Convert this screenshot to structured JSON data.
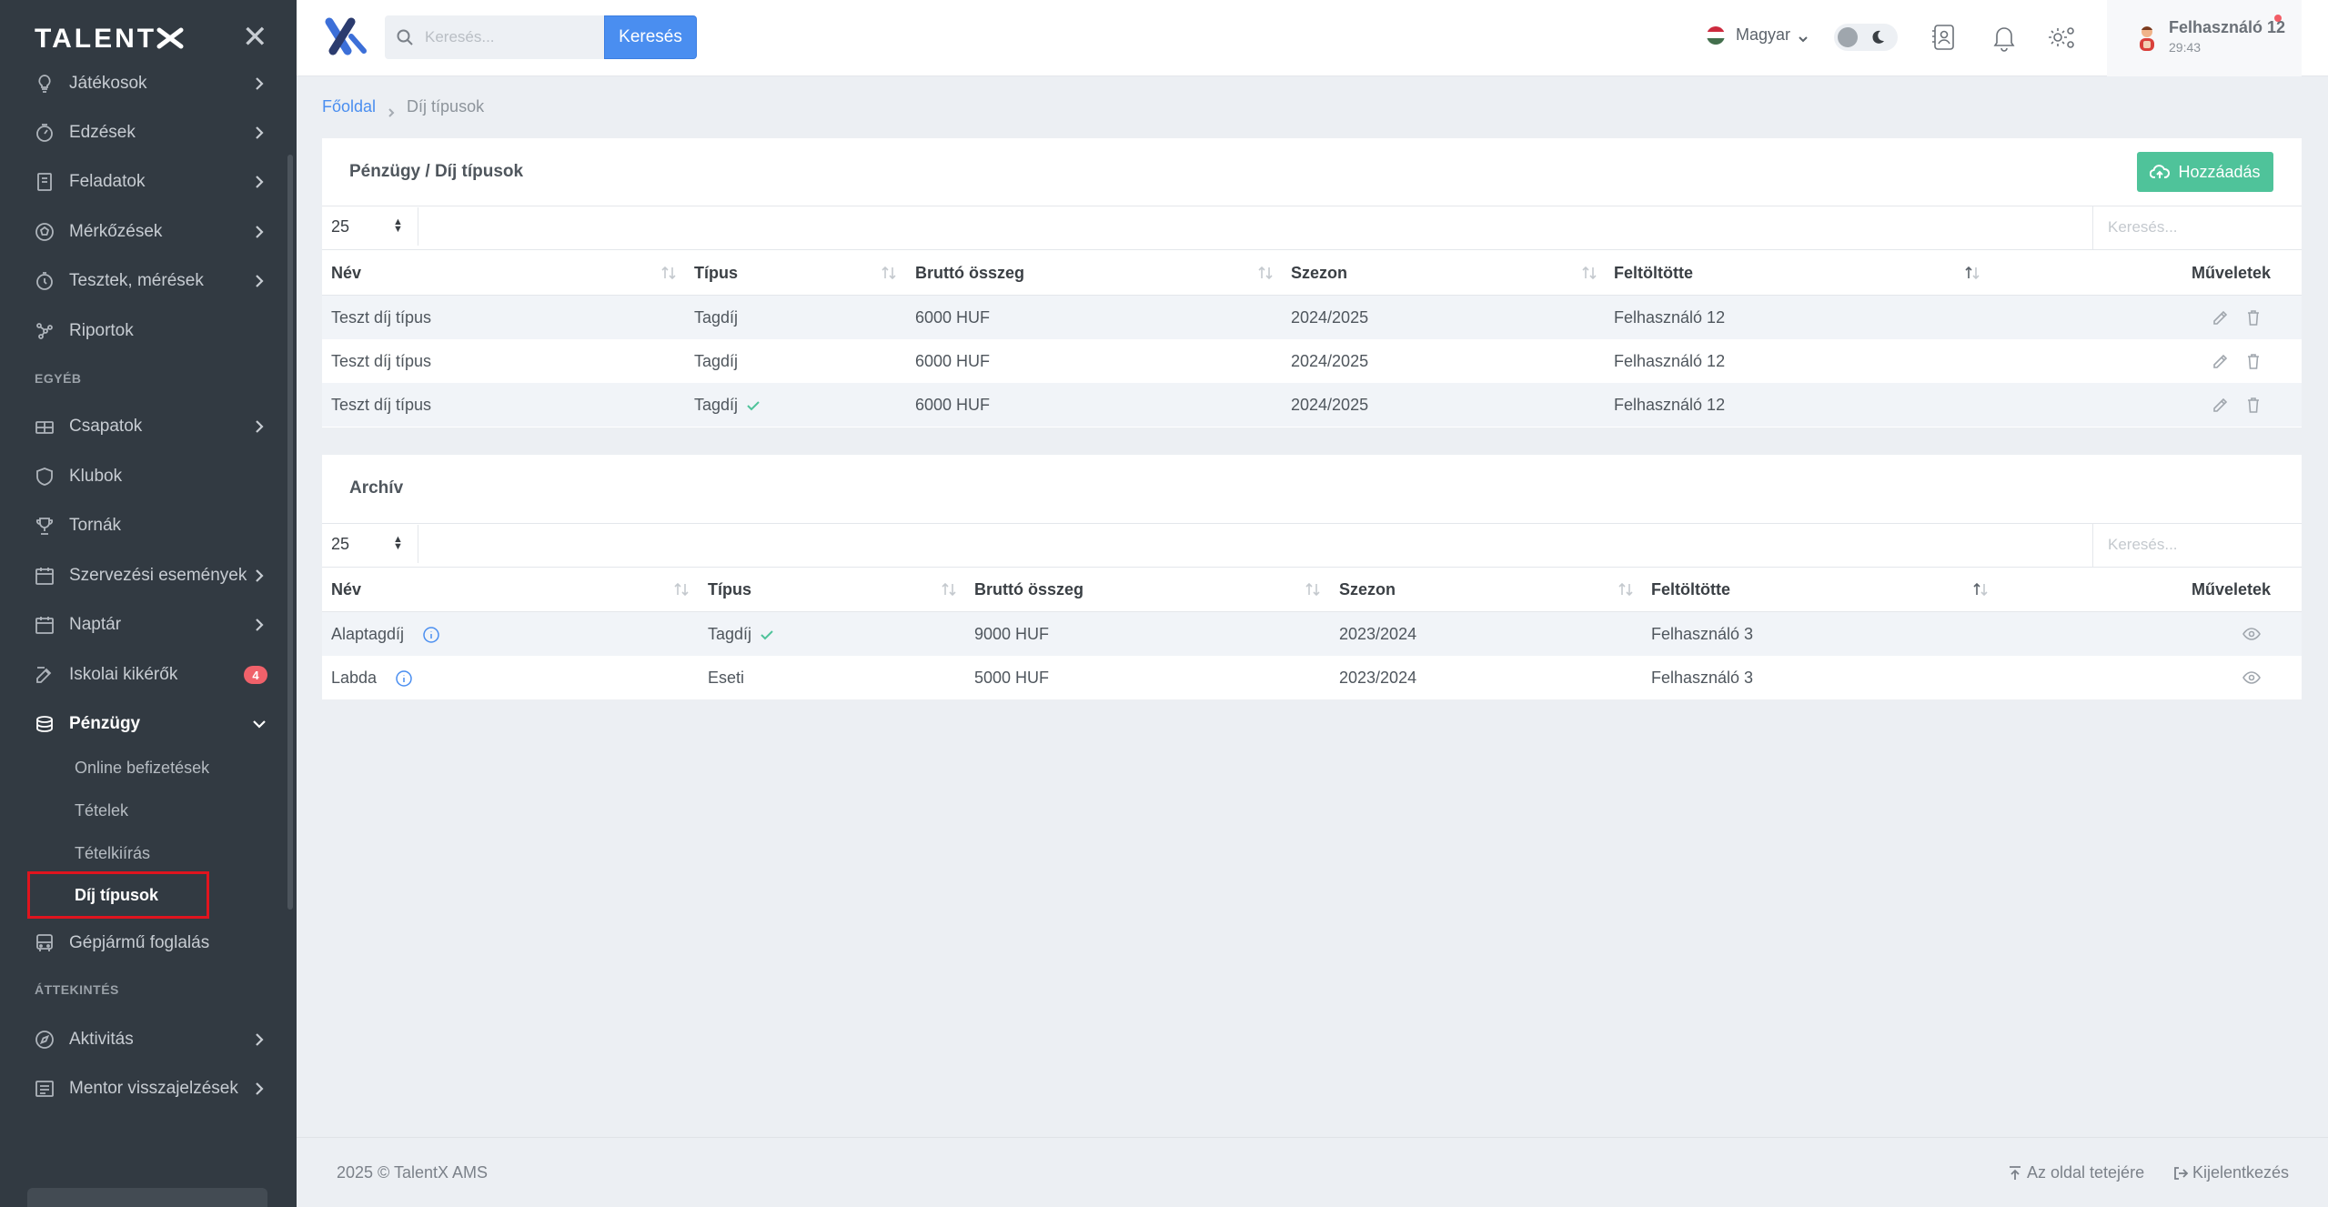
{
  "brand": {
    "logo_text": "TALENT"
  },
  "sidebar": {
    "items": [
      {
        "label": "Játékosok",
        "icon": "bulb-icon"
      },
      {
        "label": "Edzések",
        "icon": "timer-icon"
      },
      {
        "label": "Feladatok",
        "icon": "notebook-icon"
      },
      {
        "label": "Mérkőzések",
        "icon": "ball-icon"
      },
      {
        "label": "Tesztek, mérések",
        "icon": "stopwatch-icon"
      },
      {
        "label": "Riportok",
        "icon": "network-icon"
      }
    ],
    "section_other": "EGYÉB",
    "items_other": [
      {
        "label": "Csapatok",
        "icon": "team-icon"
      },
      {
        "label": "Klubok",
        "icon": "shield-icon"
      },
      {
        "label": "Tornák",
        "icon": "trophy-icon"
      },
      {
        "label": "Szervezési események",
        "icon": "calendar-icon"
      },
      {
        "label": "Naptár",
        "icon": "calendar-icon"
      },
      {
        "label": "Iskolai kikérők",
        "icon": "edit-note-icon",
        "badge": "4"
      },
      {
        "label": "Pénzügy",
        "icon": "coins-icon"
      }
    ],
    "finance_subitems": [
      "Online befizetések",
      "Tételek",
      "Tételkiírás",
      "Díj típusok"
    ],
    "vehicle": {
      "label": "Gépjármű foglalás",
      "icon": "bus-icon"
    },
    "section_overview": "ÁTTEKINTÉS",
    "items_overview": [
      {
        "label": "Aktivitás",
        "icon": "compass-icon"
      },
      {
        "label": "Mentor visszajelzések",
        "icon": "list-icon"
      }
    ]
  },
  "header": {
    "search_placeholder": "Keresés...",
    "search_button": "Keresés",
    "language": "Magyar",
    "user_name": "Felhasználó 12",
    "user_time": "29:43",
    "colors": {
      "accent": "#4a8ef0",
      "success": "#4fc39a",
      "sidebar": "#323a42"
    }
  },
  "breadcrumb": {
    "home": "Főoldal",
    "current": "Díj típusok"
  },
  "fees": {
    "title": "Pénzügy / Díj típusok",
    "add_button": "Hozzáadás",
    "page_size": "25",
    "search_placeholder": "Keresés...",
    "columns": [
      "Név",
      "Típus",
      "Bruttó összeg",
      "Szezon",
      "Feltöltötte",
      "Műveletek"
    ],
    "rows": [
      {
        "name": "Teszt díj típus",
        "type": "Tagdíj",
        "amount": "6000 HUF",
        "season": "2024/2025",
        "uploader": "Felhasználó 12",
        "checked": false
      },
      {
        "name": "Teszt díj típus",
        "type": "Tagdíj",
        "amount": "6000 HUF",
        "season": "2024/2025",
        "uploader": "Felhasználó 12",
        "checked": false
      },
      {
        "name": "Teszt díj típus",
        "type": "Tagdíj",
        "amount": "6000 HUF",
        "season": "2024/2025",
        "uploader": "Felhasználó 12",
        "checked": true
      }
    ]
  },
  "archive": {
    "title": "Archív",
    "page_size": "25",
    "search_placeholder": "Keresés...",
    "columns": [
      "Név",
      "Típus",
      "Bruttó összeg",
      "Szezon",
      "Feltöltötte",
      "Műveletek"
    ],
    "rows": [
      {
        "name": "Alaptagdíj",
        "type": "Tagdíj",
        "amount": "9000 HUF",
        "season": "2023/2024",
        "uploader": "Felhasználó 3",
        "checked": true
      },
      {
        "name": "Labda",
        "type": "Eseti",
        "amount": "5000 HUF",
        "season": "2023/2024",
        "uploader": "Felhasználó 3",
        "checked": false
      }
    ]
  },
  "footer": {
    "copyright": "2025 © TalentX AMS",
    "to_top": "Az oldal tetejére",
    "logout": "Kijelentkezés"
  }
}
